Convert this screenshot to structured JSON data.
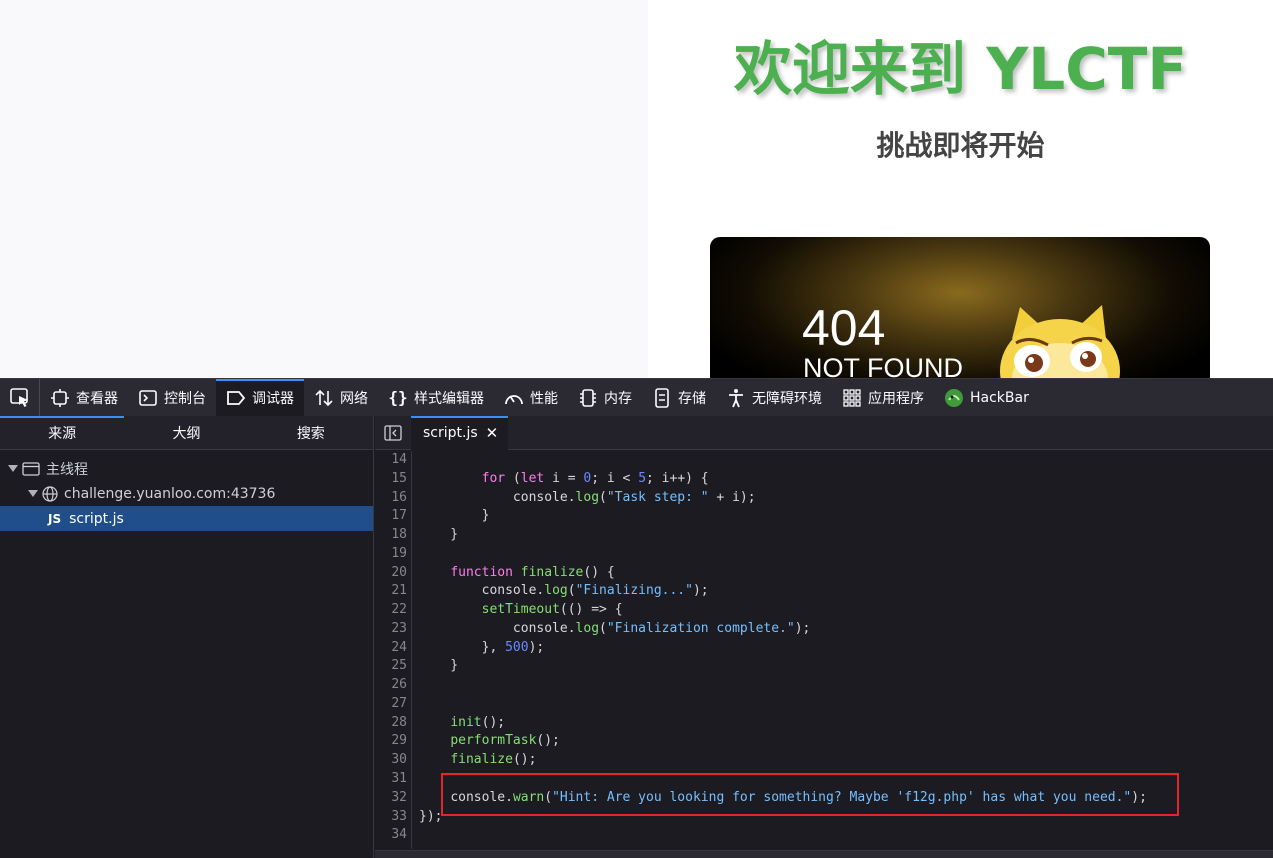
{
  "page": {
    "title": "欢迎来到 YLCTF",
    "subtitle": "挑战即将开始",
    "banner": {
      "code": "404",
      "text": "NOT FOUND"
    }
  },
  "toolbar": {
    "tabs": [
      {
        "label": "查看器",
        "icon": "inspector-icon"
      },
      {
        "label": "控制台",
        "icon": "console-icon"
      },
      {
        "label": "调试器",
        "icon": "debugger-icon",
        "active": true
      },
      {
        "label": "网络",
        "icon": "network-icon"
      },
      {
        "label": "样式编辑器",
        "icon": "style-editor-icon"
      },
      {
        "label": "性能",
        "icon": "performance-icon"
      },
      {
        "label": "内存",
        "icon": "memory-icon"
      },
      {
        "label": "存储",
        "icon": "storage-icon"
      },
      {
        "label": "无障碍环境",
        "icon": "accessibility-icon"
      },
      {
        "label": "应用程序",
        "icon": "application-icon"
      },
      {
        "label": "HackBar",
        "icon": "hackbar-icon"
      }
    ]
  },
  "sources": {
    "tabs": [
      "来源",
      "大纲",
      "搜索"
    ],
    "active_tab": "来源",
    "tree": {
      "thread": "主线程",
      "host": "challenge.yuanloo.com:43736",
      "file_badge": "JS",
      "file": "script.js"
    }
  },
  "editor": {
    "file_tab": "script.js",
    "close_glyph": "✕",
    "lines": [
      {
        "n": "14",
        "code": ""
      },
      {
        "n": "15",
        "code": "        for (let i = 0; i < 5; i++) {"
      },
      {
        "n": "16",
        "code": "            console.log(\"Task step: \" + i);"
      },
      {
        "n": "17",
        "code": "        }"
      },
      {
        "n": "18",
        "code": "    }"
      },
      {
        "n": "19",
        "code": ""
      },
      {
        "n": "20",
        "code": "    function finalize() {"
      },
      {
        "n": "21",
        "code": "        console.log(\"Finalizing...\");"
      },
      {
        "n": "22",
        "code": "        setTimeout(() => {"
      },
      {
        "n": "23",
        "code": "            console.log(\"Finalization complete.\");"
      },
      {
        "n": "24",
        "code": "        }, 500);"
      },
      {
        "n": "25",
        "code": "    }"
      },
      {
        "n": "26",
        "code": ""
      },
      {
        "n": "27",
        "code": ""
      },
      {
        "n": "28",
        "code": "    init();"
      },
      {
        "n": "29",
        "code": "    performTask();"
      },
      {
        "n": "30",
        "code": "    finalize();"
      },
      {
        "n": "31",
        "code": ""
      },
      {
        "n": "32",
        "code": "    console.warn(\"Hint: Are you looking for something? Maybe 'f12g.php' has what you need.\");"
      },
      {
        "n": "33",
        "code": "});"
      },
      {
        "n": "34",
        "code": ""
      }
    ]
  },
  "colors": {
    "title_green": "#4caf50",
    "accent_blue": "#3a8ef8",
    "highlight_red": "#e3262b",
    "selection_blue": "#204e8a"
  }
}
